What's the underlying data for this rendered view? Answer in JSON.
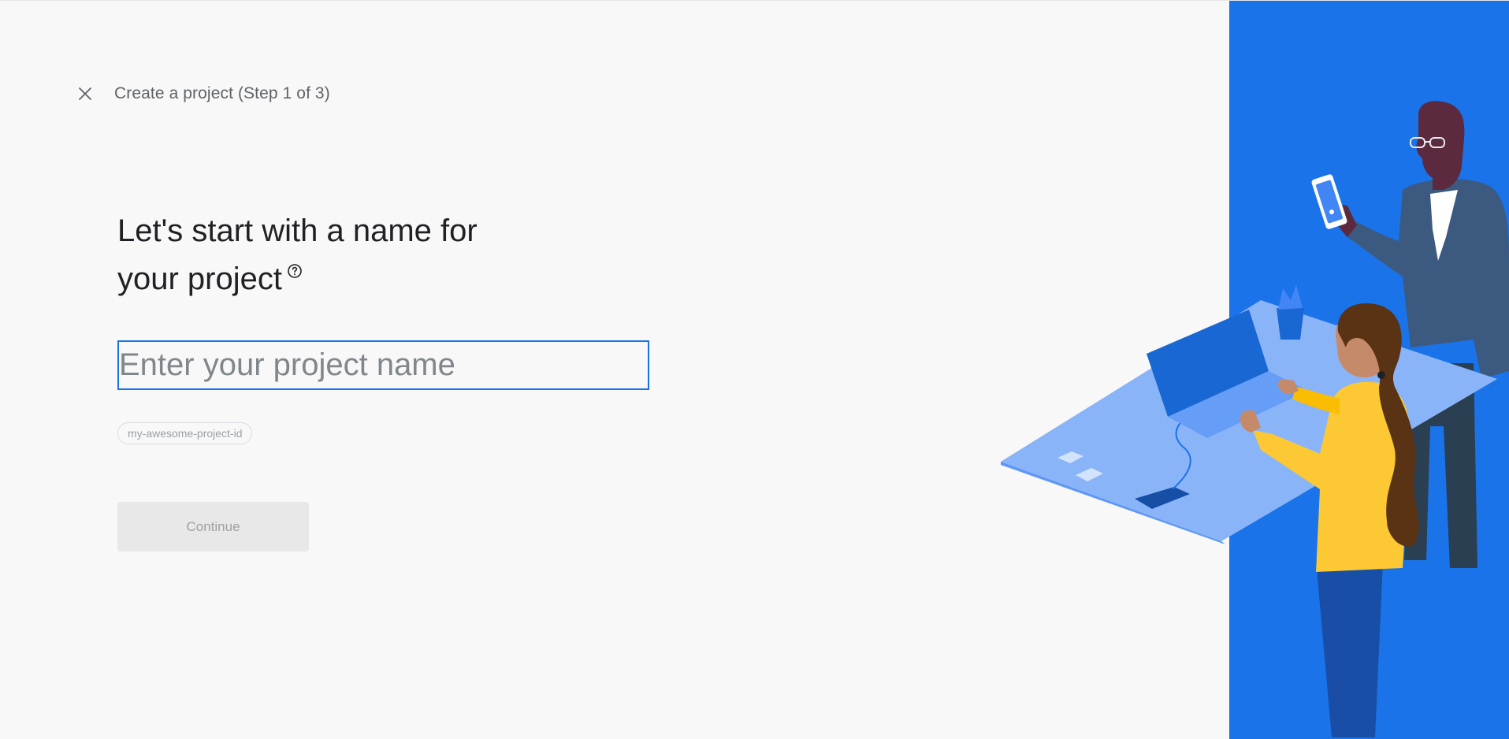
{
  "header": {
    "close_icon": "close-icon",
    "title": "Create a project (Step 1 of 3)"
  },
  "main": {
    "heading_line1": "Let's start with a name for",
    "heading_line2": "your project",
    "help_icon": "help-circle-icon",
    "project_name_input": {
      "value": "",
      "placeholder": "Enter your project name"
    },
    "project_id_chip": "my-awesome-project-id",
    "continue_label": "Continue"
  },
  "illustration": {
    "description_icon": "team-at-desk-illustration"
  },
  "colors": {
    "accent": "#1a73e8",
    "panel_blue": "#1a73e8",
    "background": "#f8f8f8",
    "button_disabled_bg": "#e8e8e8",
    "button_disabled_text": "#a0a0a0",
    "woman_shirt": "#fcc934",
    "desk": "#8ab4f8"
  }
}
